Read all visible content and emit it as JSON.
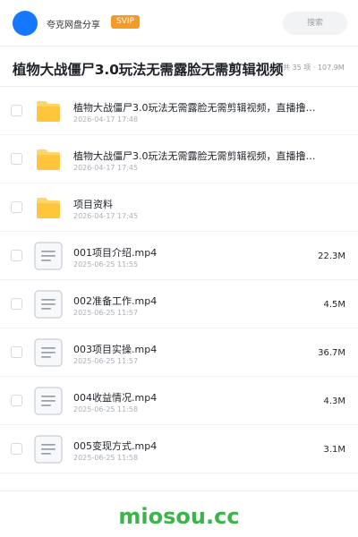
{
  "header": {
    "user_name": "夸克网盘分享",
    "vip_badge": "SVIP",
    "search_placeholder": "搜索"
  },
  "folder": {
    "title": "植物大战僵尸3.0玩法无需露脸无需剪辑视频",
    "count": "共 35 项 · 107.9M"
  },
  "files": [
    {
      "name": "植物大战僵尸3.0玩法无需露脸无需剪辑视频，直播撸…",
      "date": "2026-04-17 17:48",
      "size": "",
      "type": "folder",
      "icon": "folder-icon"
    },
    {
      "name": "植物大战僵尸3.0玩法无需露脸无需剪辑视频，直播撸…",
      "date": "2026-04-17 17:45",
      "size": "",
      "type": "folder",
      "icon": "folder-icon"
    },
    {
      "name": "项目资料",
      "date": "2026-04-17 17:45",
      "size": "",
      "type": "folder",
      "icon": "folder-icon"
    },
    {
      "name": "001项目介绍.mp4",
      "date": "2025-06-25 11:55",
      "size": "22.3M",
      "type": "file",
      "icon": "file-icon"
    },
    {
      "name": "002准备工作.mp4",
      "date": "2025-06-25 11:57",
      "size": "4.5M",
      "type": "file",
      "icon": "file-icon"
    },
    {
      "name": "003项目实操.mp4",
      "date": "2025-06-25 11:57",
      "size": "36.7M",
      "type": "file",
      "icon": "file-icon"
    },
    {
      "name": "004收益情况.mp4",
      "date": "2025-06-25 11:58",
      "size": "4.3M",
      "type": "file",
      "icon": "file-icon"
    },
    {
      "name": "005变现方式.mp4",
      "date": "2025-06-25 11:58",
      "size": "3.1M",
      "type": "file",
      "icon": "file-icon"
    }
  ],
  "footer": {
    "watermark": "miosou.cc"
  },
  "colors": {
    "avatar": "#1677ff",
    "vip_badge": "#f39a2b",
    "folder": "#ffc53d",
    "watermark": "#3cb44b"
  }
}
